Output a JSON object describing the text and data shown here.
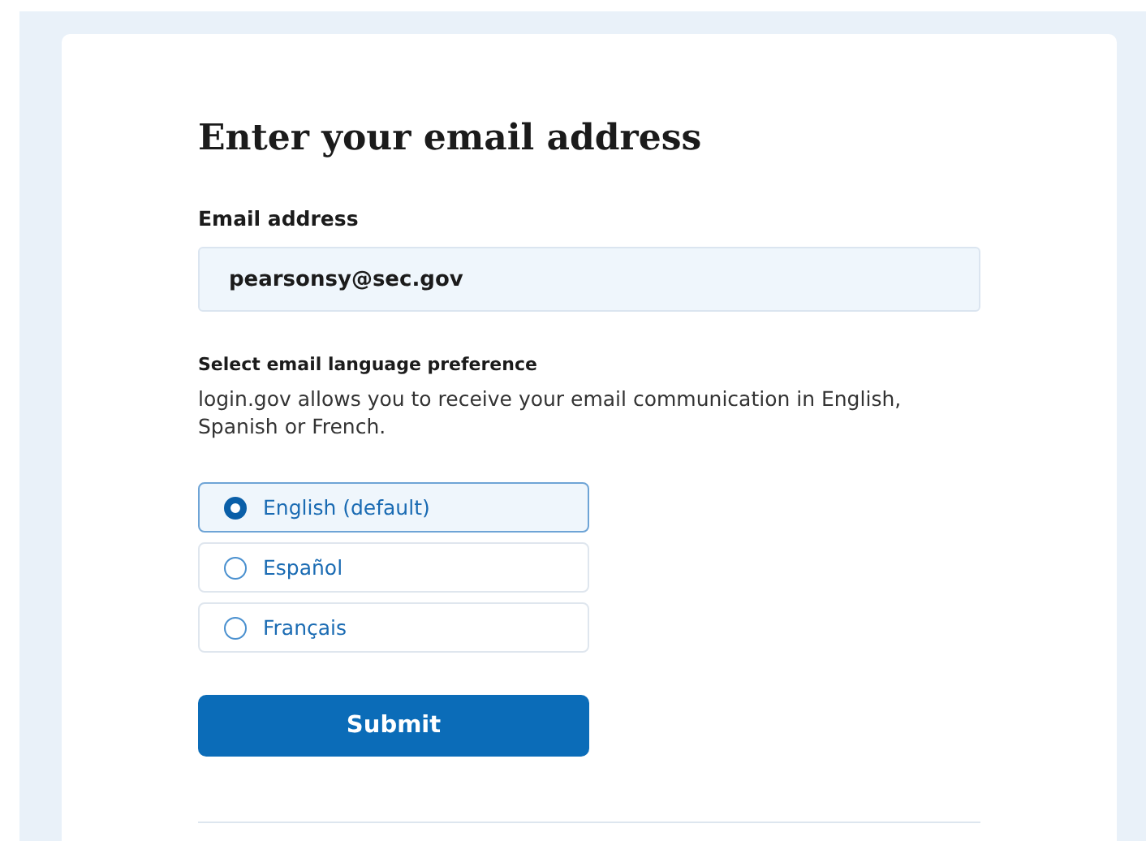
{
  "heading": "Enter your email address",
  "email": {
    "label": "Email address",
    "value": "pearsonsy@sec.gov"
  },
  "language": {
    "label": "Select email language preference",
    "hint": "login.gov allows you to receive your email communication in English, Spanish or French.",
    "options": [
      {
        "label": "English (default)",
        "selected": true
      },
      {
        "label": "Español",
        "selected": false
      },
      {
        "label": "Français",
        "selected": false
      }
    ]
  },
  "submit": "Submit"
}
